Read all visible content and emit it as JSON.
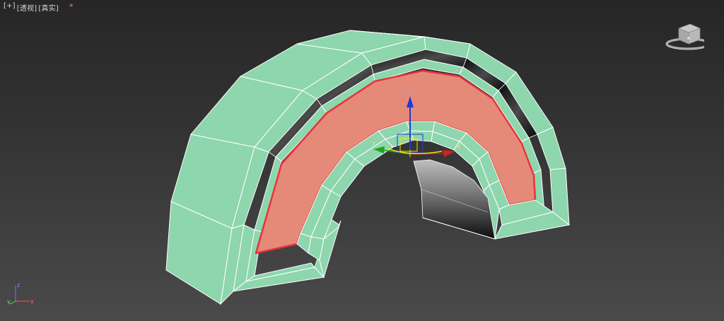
{
  "viewport": {
    "labels": {
      "plus": "[+]",
      "view": "[透视]",
      "shading": "[真实]",
      "star": "*"
    }
  },
  "gizmo": {
    "axis_z": "Z",
    "axis_x": "X",
    "axis_y": "Y"
  },
  "tripod": {
    "axis_z": "z",
    "axis_x": "x",
    "axis_y": "y"
  },
  "icons": {
    "viewcube": "viewcube-icon",
    "tripod": "axis-tripod-icon",
    "gizmo": "transform-gizmo-icon"
  },
  "colors": {
    "mesh": "#8ed6ad",
    "mesh_edge": "#ffffff",
    "selected_face": "#e58a78",
    "selected_edge": "#e6323c",
    "axis_x": "#d41f1f",
    "axis_y": "#22a322",
    "axis_z": "#1f3bd4",
    "gizmo_plane": "#e8e800"
  }
}
